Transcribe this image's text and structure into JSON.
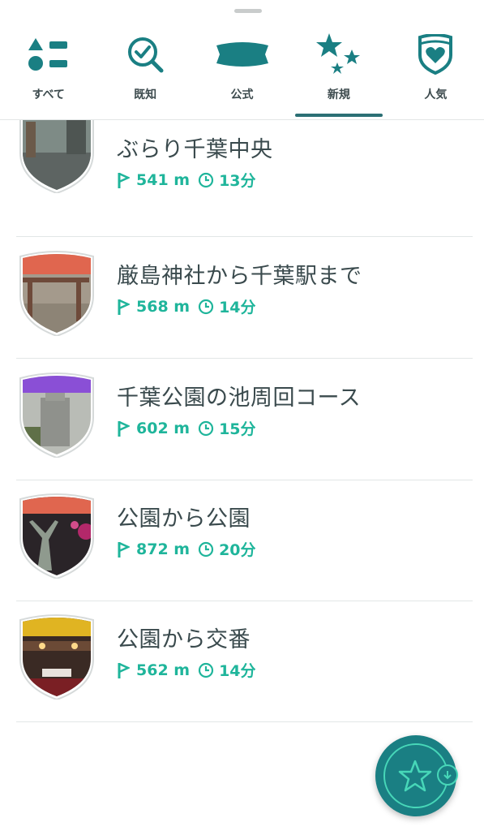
{
  "tabs": [
    {
      "label": "すべて",
      "icon": "grid-list-icon"
    },
    {
      "label": "既知",
      "icon": "search-check-icon"
    },
    {
      "label": "公式",
      "icon": "banner-icon"
    },
    {
      "label": "新規",
      "icon": "stars-icon",
      "active": true
    },
    {
      "label": "人気",
      "icon": "heart-shield-icon"
    }
  ],
  "routes": [
    {
      "title": "ぶらり千葉中央",
      "distance": "541 m",
      "duration": "13分",
      "badge_color": "#8a4fd6"
    },
    {
      "title": "厳島神社から千葉駅まで",
      "distance": "568 m",
      "duration": "14分",
      "badge_color": "#e0664f"
    },
    {
      "title": "千葉公園の池周回コース",
      "distance": "602 m",
      "duration": "15分",
      "badge_color": "#8a4fd6"
    },
    {
      "title": "公園から公園",
      "distance": "872 m",
      "duration": "20分",
      "badge_color": "#e0664f"
    },
    {
      "title": "公園から交番",
      "distance": "562 m",
      "duration": "14分",
      "badge_color": "#e0b422"
    }
  ],
  "colors": {
    "accent": "#1fb59b",
    "teal": "#1a7f83",
    "text": "#3a4a4d"
  },
  "fab": {
    "icon": "star-download-icon"
  }
}
